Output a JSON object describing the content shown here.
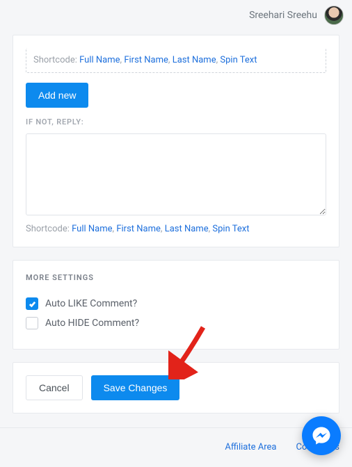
{
  "header": {
    "username": "Sreehari Sreehu"
  },
  "shortcode": {
    "label": "Shortcode:",
    "links": [
      "Full Name",
      "First Name",
      "Last Name",
      "Spin Text"
    ]
  },
  "buttons": {
    "add_new": "Add new",
    "cancel": "Cancel",
    "save": "Save Changes"
  },
  "labels": {
    "if_not_reply": "IF NOT, REPLY:",
    "more_settings": "MORE SETTINGS"
  },
  "settings": {
    "auto_like": {
      "label": "Auto LIKE Comment?",
      "checked": true
    },
    "auto_hide": {
      "label": "Auto HIDE Comment?",
      "checked": false
    }
  },
  "footer": {
    "affiliate": "Affiliate Area",
    "contact": "Contact us"
  },
  "reply_value": ""
}
